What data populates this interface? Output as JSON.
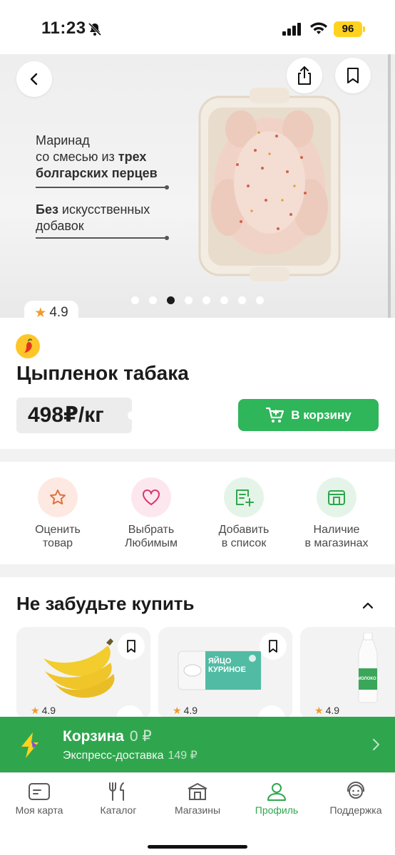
{
  "status_bar": {
    "time": "11:23",
    "battery": "96"
  },
  "hero": {
    "text_1_plain_a": "Маринад",
    "text_1_plain_b": "со смесью из ",
    "text_1_bold_a": "трех",
    "text_1_bold_b": "болгарских перцев",
    "text_2_bold": "Без",
    "text_2_plain_a": " искусственных",
    "text_2_plain_b": "добавок",
    "dots_count": 8,
    "active_dot": 3
  },
  "product": {
    "rating": "4.9",
    "title": "Цыпленок табака",
    "price": "498₽/кг",
    "cart_button_label": "В корзину"
  },
  "actions": [
    {
      "label_1": "Оценить",
      "label_2": "товар"
    },
    {
      "label_1": "Выбрать",
      "label_2": "Любимым"
    },
    {
      "label_1": "Добавить",
      "label_2": "в список"
    },
    {
      "label_1": "Наличие",
      "label_2": "в магазинах"
    }
  ],
  "section": {
    "title": "Не забудьте купить",
    "cards": [
      {
        "rating": "4.9"
      },
      {
        "rating": "4.9",
        "pack_text_1": "ЯЙЦО",
        "pack_text_2": "КУРИНОЕ"
      },
      {
        "rating": "4.9",
        "bottle_text": "МОЛОКО"
      }
    ]
  },
  "cart_bar": {
    "title": "Корзина",
    "amount": "0 ₽",
    "delivery": "Экспресс-доставка",
    "delivery_fee": "149 ₽"
  },
  "tabs": [
    {
      "label": "Моя карта",
      "icon": "card-icon"
    },
    {
      "label": "Каталог",
      "icon": "cutlery-icon"
    },
    {
      "label": "Магазины",
      "icon": "store-icon"
    },
    {
      "label": "Профиль",
      "icon": "profile-icon",
      "active": true
    },
    {
      "label": "Поддержка",
      "icon": "support-icon"
    }
  ],
  "colors": {
    "accent": "#2fb55a",
    "cartbar": "#2fa64d",
    "star": "#f09a2a",
    "battery": "#ffd21f"
  }
}
